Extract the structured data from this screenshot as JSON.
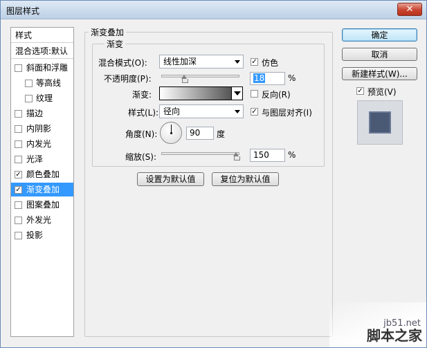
{
  "window": {
    "title": "图层样式",
    "close_glyph": "✕"
  },
  "left_panel": {
    "styles_header": "样式",
    "blend_options_header": "混合选项:默认",
    "items": [
      {
        "label": "斜面和浮雕",
        "checked": false,
        "indent": false
      },
      {
        "label": "等高线",
        "checked": false,
        "indent": true
      },
      {
        "label": "纹理",
        "checked": false,
        "indent": true
      },
      {
        "label": "描边",
        "checked": false,
        "indent": false
      },
      {
        "label": "内阴影",
        "checked": false,
        "indent": false
      },
      {
        "label": "内发光",
        "checked": false,
        "indent": false
      },
      {
        "label": "光泽",
        "checked": false,
        "indent": false
      },
      {
        "label": "颜色叠加",
        "checked": true,
        "indent": false
      },
      {
        "label": "渐变叠加",
        "checked": true,
        "indent": false,
        "selected": true
      },
      {
        "label": "图案叠加",
        "checked": false,
        "indent": false
      },
      {
        "label": "外发光",
        "checked": false,
        "indent": false
      },
      {
        "label": "投影",
        "checked": false,
        "indent": false
      }
    ],
    "check_glyph": "✓"
  },
  "gradient_overlay": {
    "group_title": "渐变叠加",
    "sub_group_title": "渐变",
    "blend_mode_label": "混合模式(O):",
    "blend_mode_value": "线性加深",
    "dither_label": "仿色",
    "dither_checked": true,
    "opacity_label": "不透明度(P):",
    "opacity_value": "18",
    "opacity_fraction": 0.18,
    "percent_sign": "%",
    "gradient_label": "渐变:",
    "reverse_label": "反向(R)",
    "reverse_checked": false,
    "style_label": "样式(L):",
    "style_value": "径向",
    "align_label": "与图层对齐(I)",
    "align_checked": true,
    "angle_label": "角度(N):",
    "angle_value": "90",
    "angle_unit": "度",
    "scale_label": "缩放(S):",
    "scale_value": "150",
    "scale_fraction": 1.0,
    "set_default_button": "设置为默认值",
    "reset_default_button": "复位为默认值"
  },
  "right_panel": {
    "ok_button": "确定",
    "cancel_button": "取消",
    "new_style_button": "新建样式(W)...",
    "preview_label": "预览(V)",
    "preview_checked": true,
    "preview_color": "#4a5a75"
  },
  "watermark": {
    "line1": "jb51.net",
    "line2": "脚本之家"
  },
  "colors": {
    "selection": "#3399ff",
    "titlebar": "#bdd0e6",
    "close": "#c8452f"
  }
}
